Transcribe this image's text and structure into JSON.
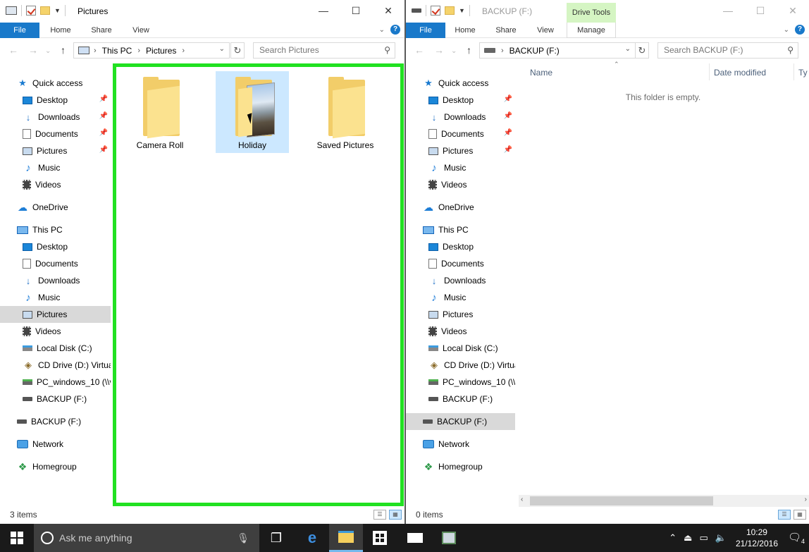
{
  "left_window": {
    "title": "Pictures",
    "ribbon_tabs": [
      "File",
      "Home",
      "Share",
      "View"
    ],
    "address": {
      "segments": [
        "This PC",
        "Pictures"
      ]
    },
    "search_placeholder": "Search Pictures",
    "nav_items": [
      {
        "label": "Quick access",
        "icon": "quick-access-star-icon",
        "level": 0
      },
      {
        "label": "Desktop",
        "icon": "desktop-icon",
        "level": 1,
        "pinned": true
      },
      {
        "label": "Downloads",
        "icon": "downloads-icon",
        "level": 1,
        "pinned": true
      },
      {
        "label": "Documents",
        "icon": "documents-icon",
        "level": 1,
        "pinned": true
      },
      {
        "label": "Pictures",
        "icon": "pictures-icon",
        "level": 1,
        "pinned": true
      },
      {
        "label": "Music",
        "icon": "music-icon",
        "level": 1
      },
      {
        "label": "Videos",
        "icon": "videos-icon",
        "level": 1
      },
      {
        "label": "OneDrive",
        "icon": "onedrive-icon",
        "level": 0
      },
      {
        "label": "This PC",
        "icon": "this-pc-icon",
        "level": 0
      },
      {
        "label": "Desktop",
        "icon": "desktop-icon",
        "level": 1
      },
      {
        "label": "Documents",
        "icon": "documents-icon",
        "level": 1
      },
      {
        "label": "Downloads",
        "icon": "downloads-icon",
        "level": 1
      },
      {
        "label": "Music",
        "icon": "music-icon",
        "level": 1
      },
      {
        "label": "Pictures",
        "icon": "pictures-icon",
        "level": 1,
        "selected": true
      },
      {
        "label": "Videos",
        "icon": "videos-icon",
        "level": 1
      },
      {
        "label": "Local Disk (C:)",
        "icon": "local-disk-icon",
        "level": 1
      },
      {
        "label": "CD Drive (D:) Virtua",
        "icon": "cd-drive-icon",
        "level": 1
      },
      {
        "label": "PC_windows_10 (\\\\v",
        "icon": "network-drive-icon",
        "level": 1
      },
      {
        "label": "BACKUP (F:)",
        "icon": "usb-drive-icon",
        "level": 1
      },
      {
        "label": "BACKUP (F:)",
        "icon": "usb-drive-icon",
        "level": 0
      },
      {
        "label": "Network",
        "icon": "network-icon",
        "level": 0
      },
      {
        "label": "Homegroup",
        "icon": "homegroup-icon",
        "level": 0
      }
    ],
    "folders": [
      {
        "label": "Camera Roll",
        "selected": false,
        "photo": false
      },
      {
        "label": "Holiday",
        "selected": true,
        "photo": true
      },
      {
        "label": "Saved Pictures",
        "selected": false,
        "photo": false
      }
    ],
    "status": "3 items"
  },
  "right_window": {
    "title": "BACKUP (F:)",
    "context_tab": "Drive Tools",
    "ribbon_tabs": [
      "File",
      "Home",
      "Share",
      "View",
      "Manage"
    ],
    "address": {
      "segments": [
        "BACKUP (F:)"
      ]
    },
    "search_placeholder": "Search BACKUP (F:)",
    "nav_items": [
      {
        "label": "Quick access",
        "icon": "quick-access-star-icon",
        "level": 0
      },
      {
        "label": "Desktop",
        "icon": "desktop-icon",
        "level": 1,
        "pinned": true
      },
      {
        "label": "Downloads",
        "icon": "downloads-icon",
        "level": 1,
        "pinned": true
      },
      {
        "label": "Documents",
        "icon": "documents-icon",
        "level": 1,
        "pinned": true
      },
      {
        "label": "Pictures",
        "icon": "pictures-icon",
        "level": 1,
        "pinned": true
      },
      {
        "label": "Music",
        "icon": "music-icon",
        "level": 1
      },
      {
        "label": "Videos",
        "icon": "videos-icon",
        "level": 1
      },
      {
        "label": "OneDrive",
        "icon": "onedrive-icon",
        "level": 0
      },
      {
        "label": "This PC",
        "icon": "this-pc-icon",
        "level": 0
      },
      {
        "label": "Desktop",
        "icon": "desktop-icon",
        "level": 1
      },
      {
        "label": "Documents",
        "icon": "documents-icon",
        "level": 1
      },
      {
        "label": "Downloads",
        "icon": "downloads-icon",
        "level": 1
      },
      {
        "label": "Music",
        "icon": "music-icon",
        "level": 1
      },
      {
        "label": "Pictures",
        "icon": "pictures-icon",
        "level": 1
      },
      {
        "label": "Videos",
        "icon": "videos-icon",
        "level": 1
      },
      {
        "label": "Local Disk (C:)",
        "icon": "local-disk-icon",
        "level": 1
      },
      {
        "label": "CD Drive (D:) Virtua",
        "icon": "cd-drive-icon",
        "level": 1
      },
      {
        "label": "PC_windows_10 (\\\\v",
        "icon": "network-drive-icon",
        "level": 1
      },
      {
        "label": "BACKUP (F:)",
        "icon": "usb-drive-icon",
        "level": 1
      },
      {
        "label": "BACKUP (F:)",
        "icon": "usb-drive-icon",
        "level": 0,
        "selected": true
      },
      {
        "label": "Network",
        "icon": "network-icon",
        "level": 0
      },
      {
        "label": "Homegroup",
        "icon": "homegroup-icon",
        "level": 0
      }
    ],
    "columns": [
      "Name",
      "Date modified",
      "Ty"
    ],
    "empty_message": "This folder is empty.",
    "status": "0 items"
  },
  "taskbar": {
    "search_placeholder": "Ask me anything",
    "time": "10:29",
    "date": "21/12/2016",
    "notification_count": "4"
  },
  "colors": {
    "accent": "#1979ca",
    "selection_highlight": "#21e121",
    "context_tab": "#d5f5c3"
  }
}
